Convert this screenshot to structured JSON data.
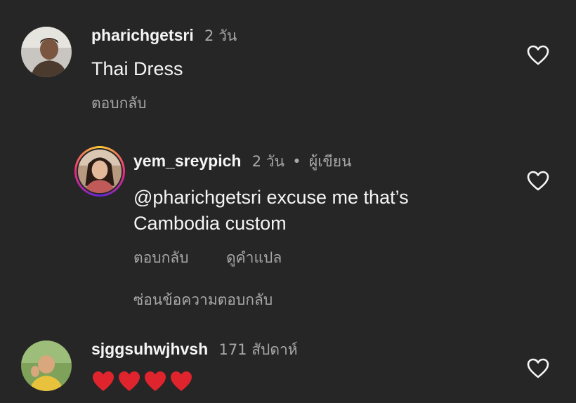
{
  "comments": [
    {
      "username": "pharichgetsri",
      "time": "2 วัน",
      "text": "Thai Dress",
      "reply_label": "ตอบกลับ"
    },
    {
      "username": "yem_sreypich",
      "time": "2 วัน",
      "separator": "•",
      "author_tag": "ผู้เขียน",
      "text_line1": "@pharichgetsri excuse me that’s",
      "text_line2": "Cambodia custom",
      "reply_label": "ตอบกลับ",
      "translate_label": "ดูคำแปล",
      "hide_replies_label": "ซ่อนข้อความตอบกลับ"
    },
    {
      "username": "sjggsuhwjhvsh",
      "time": "171 สัปดาห์",
      "text_emoji": "❤️❤️❤️❤️"
    }
  ],
  "icons": {
    "like": "heart-outline-icon",
    "emoji": "red-heart-emoji"
  },
  "colors": {
    "background": "#262626",
    "primary_text": "#f5f5f5",
    "secondary_text": "#a8a8a8",
    "emoji_heart": "#e0242e"
  }
}
